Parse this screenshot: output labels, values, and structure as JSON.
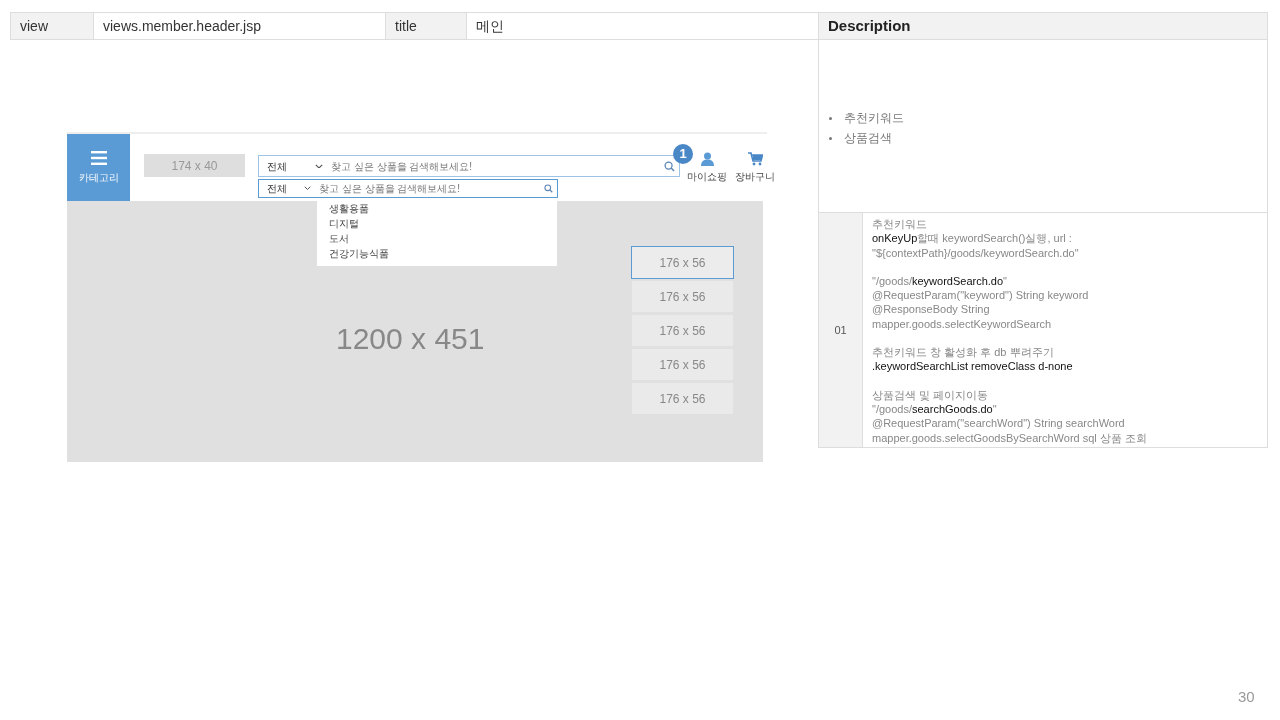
{
  "header_row": [
    {
      "text": "view",
      "kind": "label"
    },
    {
      "text": "views.member.header.jsp",
      "kind": "value"
    },
    {
      "text": "title",
      "kind": "label"
    },
    {
      "text": "메인",
      "kind": "value"
    }
  ],
  "description": {
    "title": "Description",
    "bullets": [
      "추천키워드",
      "상품검색"
    ],
    "rows": [
      {
        "number": "01",
        "paragraphs": [
          [
            "추천키워드",
            "**onKeyUp**할때 keywordSearch()실행,  url :",
            "\"${contextPath}/goods/keywordSearch.do\""
          ],
          [
            "\"/goods/**keywordSearch.do**\"",
            "@RequestParam(\"keyword\") String keyword",
            "@ResponseBody String",
            "mapper.goods.selectKeywordSearch"
          ],
          [
            "추천키워드 창 활성화 후 db 뿌려주기",
            "**.keywordSearchList removeClass d-none**"
          ],
          [
            "상품검색 및 페이지이동",
            "\"/goods/**searchGoods.do**\"",
            "@RequestParam(\"searchWord\") String searchWord",
            "mapper.goods.selectGoodsBySearchWord sql 상품 조회"
          ]
        ]
      }
    ]
  },
  "mockup": {
    "category_label": "카테고리",
    "logo_placeholder": "174 x 40",
    "search": {
      "category": "전체",
      "placeholder": "찾고 싶은 상품을 검색해보세요!"
    },
    "search_small": {
      "category": "전체",
      "placeholder": "찾고 싶은 상품을 검색해보세요!"
    },
    "keyword_list": [
      "생활용품",
      "디지털",
      "도서",
      "건강기능식품"
    ],
    "callout": "1",
    "icons": [
      {
        "kind": "user",
        "label": "마이쇼핑"
      },
      {
        "kind": "cart",
        "label": "장바구니"
      }
    ],
    "banner": "1200 x 451",
    "side_items": [
      {
        "text": "176 x 56",
        "selected": true
      },
      {
        "text": "176 x 56",
        "selected": false
      },
      {
        "text": "176 x 56",
        "selected": false
      },
      {
        "text": "176 x 56",
        "selected": false
      },
      {
        "text": "176 x 56",
        "selected": false
      }
    ]
  },
  "page_number": "30"
}
